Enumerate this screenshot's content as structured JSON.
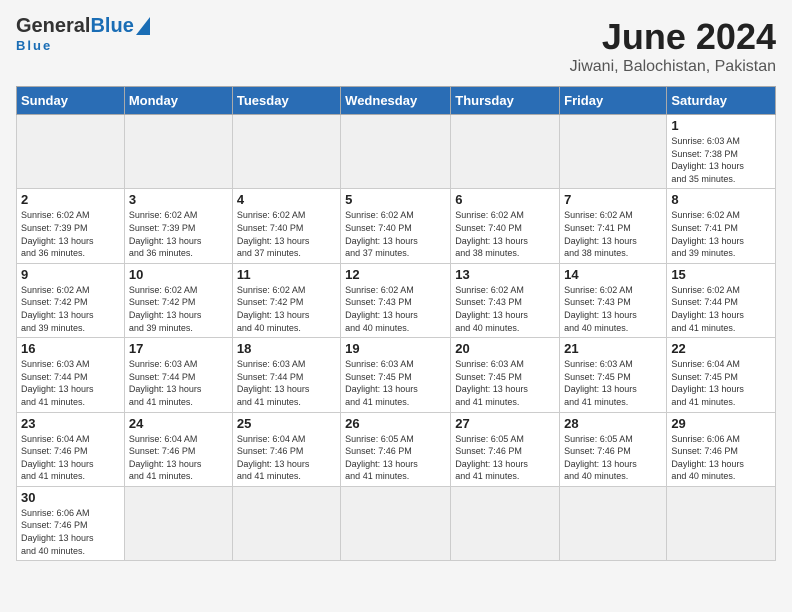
{
  "header": {
    "logo_general": "General",
    "logo_blue": "Blue",
    "title": "June 2024",
    "subtitle": "Jiwani, Balochistan, Pakistan"
  },
  "weekdays": [
    "Sunday",
    "Monday",
    "Tuesday",
    "Wednesday",
    "Thursday",
    "Friday",
    "Saturday"
  ],
  "weeks": [
    [
      {
        "day": "",
        "info": ""
      },
      {
        "day": "",
        "info": ""
      },
      {
        "day": "",
        "info": ""
      },
      {
        "day": "",
        "info": ""
      },
      {
        "day": "",
        "info": ""
      },
      {
        "day": "",
        "info": ""
      },
      {
        "day": "1",
        "info": "Sunrise: 6:03 AM\nSunset: 7:38 PM\nDaylight: 13 hours\nand 35 minutes."
      }
    ],
    [
      {
        "day": "2",
        "info": "Sunrise: 6:02 AM\nSunset: 7:39 PM\nDaylight: 13 hours\nand 36 minutes."
      },
      {
        "day": "3",
        "info": "Sunrise: 6:02 AM\nSunset: 7:39 PM\nDaylight: 13 hours\nand 36 minutes."
      },
      {
        "day": "4",
        "info": "Sunrise: 6:02 AM\nSunset: 7:40 PM\nDaylight: 13 hours\nand 37 minutes."
      },
      {
        "day": "5",
        "info": "Sunrise: 6:02 AM\nSunset: 7:40 PM\nDaylight: 13 hours\nand 37 minutes."
      },
      {
        "day": "6",
        "info": "Sunrise: 6:02 AM\nSunset: 7:40 PM\nDaylight: 13 hours\nand 38 minutes."
      },
      {
        "day": "7",
        "info": "Sunrise: 6:02 AM\nSunset: 7:41 PM\nDaylight: 13 hours\nand 38 minutes."
      },
      {
        "day": "8",
        "info": "Sunrise: 6:02 AM\nSunset: 7:41 PM\nDaylight: 13 hours\nand 39 minutes."
      }
    ],
    [
      {
        "day": "9",
        "info": "Sunrise: 6:02 AM\nSunset: 7:42 PM\nDaylight: 13 hours\nand 39 minutes."
      },
      {
        "day": "10",
        "info": "Sunrise: 6:02 AM\nSunset: 7:42 PM\nDaylight: 13 hours\nand 39 minutes."
      },
      {
        "day": "11",
        "info": "Sunrise: 6:02 AM\nSunset: 7:42 PM\nDaylight: 13 hours\nand 40 minutes."
      },
      {
        "day": "12",
        "info": "Sunrise: 6:02 AM\nSunset: 7:43 PM\nDaylight: 13 hours\nand 40 minutes."
      },
      {
        "day": "13",
        "info": "Sunrise: 6:02 AM\nSunset: 7:43 PM\nDaylight: 13 hours\nand 40 minutes."
      },
      {
        "day": "14",
        "info": "Sunrise: 6:02 AM\nSunset: 7:43 PM\nDaylight: 13 hours\nand 40 minutes."
      },
      {
        "day": "15",
        "info": "Sunrise: 6:02 AM\nSunset: 7:44 PM\nDaylight: 13 hours\nand 41 minutes."
      }
    ],
    [
      {
        "day": "16",
        "info": "Sunrise: 6:03 AM\nSunset: 7:44 PM\nDaylight: 13 hours\nand 41 minutes."
      },
      {
        "day": "17",
        "info": "Sunrise: 6:03 AM\nSunset: 7:44 PM\nDaylight: 13 hours\nand 41 minutes."
      },
      {
        "day": "18",
        "info": "Sunrise: 6:03 AM\nSunset: 7:44 PM\nDaylight: 13 hours\nand 41 minutes."
      },
      {
        "day": "19",
        "info": "Sunrise: 6:03 AM\nSunset: 7:45 PM\nDaylight: 13 hours\nand 41 minutes."
      },
      {
        "day": "20",
        "info": "Sunrise: 6:03 AM\nSunset: 7:45 PM\nDaylight: 13 hours\nand 41 minutes."
      },
      {
        "day": "21",
        "info": "Sunrise: 6:03 AM\nSunset: 7:45 PM\nDaylight: 13 hours\nand 41 minutes."
      },
      {
        "day": "22",
        "info": "Sunrise: 6:04 AM\nSunset: 7:45 PM\nDaylight: 13 hours\nand 41 minutes."
      }
    ],
    [
      {
        "day": "23",
        "info": "Sunrise: 6:04 AM\nSunset: 7:46 PM\nDaylight: 13 hours\nand 41 minutes."
      },
      {
        "day": "24",
        "info": "Sunrise: 6:04 AM\nSunset: 7:46 PM\nDaylight: 13 hours\nand 41 minutes."
      },
      {
        "day": "25",
        "info": "Sunrise: 6:04 AM\nSunset: 7:46 PM\nDaylight: 13 hours\nand 41 minutes."
      },
      {
        "day": "26",
        "info": "Sunrise: 6:05 AM\nSunset: 7:46 PM\nDaylight: 13 hours\nand 41 minutes."
      },
      {
        "day": "27",
        "info": "Sunrise: 6:05 AM\nSunset: 7:46 PM\nDaylight: 13 hours\nand 41 minutes."
      },
      {
        "day": "28",
        "info": "Sunrise: 6:05 AM\nSunset: 7:46 PM\nDaylight: 13 hours\nand 40 minutes."
      },
      {
        "day": "29",
        "info": "Sunrise: 6:06 AM\nSunset: 7:46 PM\nDaylight: 13 hours\nand 40 minutes."
      }
    ],
    [
      {
        "day": "30",
        "info": "Sunrise: 6:06 AM\nSunset: 7:46 PM\nDaylight: 13 hours\nand 40 minutes."
      },
      {
        "day": "",
        "info": ""
      },
      {
        "day": "",
        "info": ""
      },
      {
        "day": "",
        "info": ""
      },
      {
        "day": "",
        "info": ""
      },
      {
        "day": "",
        "info": ""
      },
      {
        "day": "",
        "info": ""
      }
    ]
  ]
}
